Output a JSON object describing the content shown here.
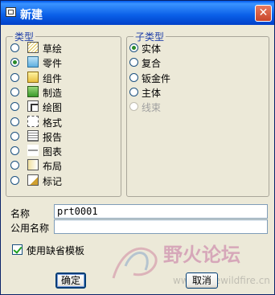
{
  "window": {
    "title": "新建",
    "close_glyph": "✕"
  },
  "type_group": {
    "legend": "类型",
    "items": [
      {
        "label": "草绘",
        "icon": "sketch-icon",
        "selected": false
      },
      {
        "label": "零件",
        "icon": "part-icon",
        "selected": true
      },
      {
        "label": "组件",
        "icon": "assembly-icon",
        "selected": false
      },
      {
        "label": "制造",
        "icon": "manufacturing-icon",
        "selected": false
      },
      {
        "label": "绘图",
        "icon": "drawing-icon",
        "selected": false
      },
      {
        "label": "格式",
        "icon": "format-icon",
        "selected": false
      },
      {
        "label": "报告",
        "icon": "report-icon",
        "selected": false
      },
      {
        "label": "图表",
        "icon": "diagram-icon",
        "selected": false
      },
      {
        "label": "布局",
        "icon": "layout-icon",
        "selected": false
      },
      {
        "label": "标记",
        "icon": "markup-icon",
        "selected": false
      }
    ]
  },
  "subtype_group": {
    "legend": "子类型",
    "items": [
      {
        "label": "实体",
        "selected": true,
        "enabled": true
      },
      {
        "label": "复合",
        "selected": false,
        "enabled": true
      },
      {
        "label": "钣金件",
        "selected": false,
        "enabled": true
      },
      {
        "label": "主体",
        "selected": false,
        "enabled": true
      },
      {
        "label": "线束",
        "selected": false,
        "enabled": false
      }
    ]
  },
  "name_field": {
    "label": "名称",
    "value": "prt0001"
  },
  "common_name_field": {
    "label": "公用名称",
    "value": ""
  },
  "default_template": {
    "label": "使用缺省模板",
    "checked": true
  },
  "buttons": {
    "ok": "确定",
    "cancel": "取消"
  },
  "watermark": {
    "text": "野火论坛",
    "url_text": "www.proewildfire.cn"
  }
}
